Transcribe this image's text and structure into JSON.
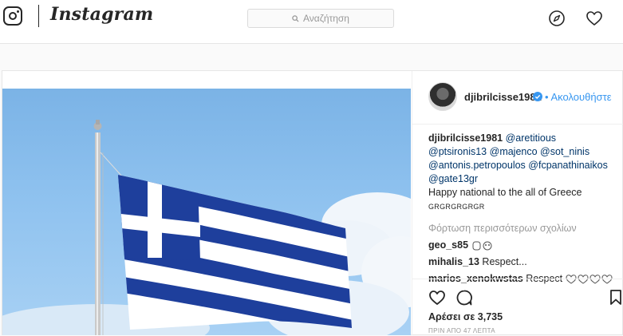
{
  "header": {
    "logo_text": "Instagram",
    "search_placeholder": "Αναζήτηση",
    "icons": [
      "instagram-camera-icon",
      "search-icon",
      "compass-icon",
      "heart-icon"
    ]
  },
  "post": {
    "username": "djibrilcisse1981",
    "follow_label": "Ακολουθήστε",
    "caption": {
      "author": "djibrilcisse1981",
      "mentions": [
        "@aretitious",
        "@ptsironis13",
        "@majenco",
        "@sot_ninis",
        "@antonis.petropoulos",
        "@fcpanathinaikos",
        "@gate13gr"
      ],
      "text": "Happy national to the all of Greece",
      "small_text": "GRGRGRGRGR"
    },
    "load_more": "Φόρτωση περισσότερων σχολίων",
    "comments": [
      {
        "user": "geo_s85",
        "text": ""
      },
      {
        "user": "mihalis_13",
        "text": "Respect..."
      },
      {
        "user": "marios_xenokwstas",
        "text": "Respect"
      }
    ],
    "likes": "Αρέσει σε 3,735",
    "time_ago": "ΠΡΙΝ ΑΠΟ 47 ΛΕΠΤΑ"
  },
  "colors": {
    "accent": "#3897f0",
    "mention": "#003569",
    "flag_blue": "#1e3f9c",
    "sky": "#8fc2ef"
  }
}
